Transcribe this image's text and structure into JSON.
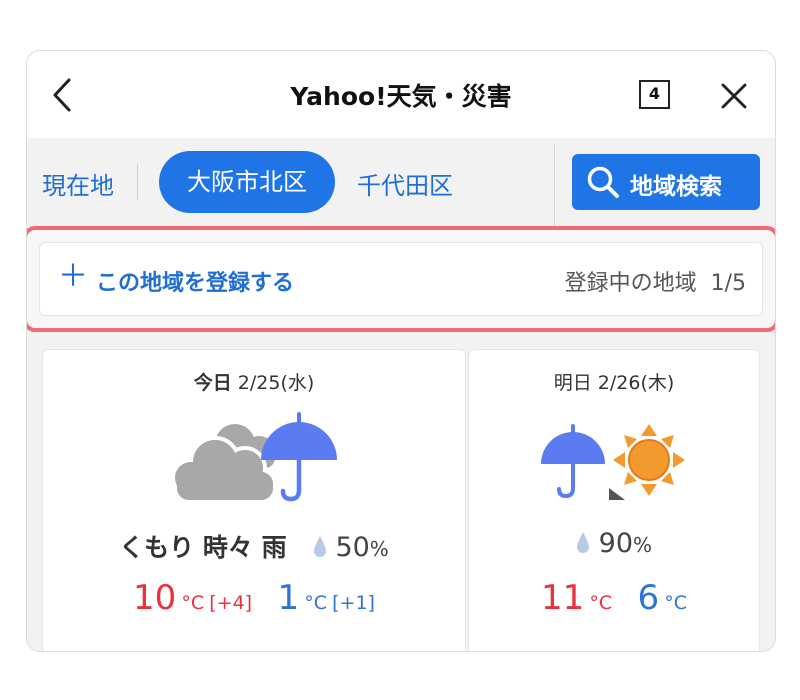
{
  "header": {
    "title": "Yahoo!天気・災害",
    "tab_count": "4",
    "back_icon": "chevron-left-icon",
    "close_icon": "close-icon"
  },
  "regions": {
    "current": "現在地",
    "selected": "大阪市北区",
    "other": "千代田区",
    "search_label": "地域検索",
    "search_icon": "search-icon"
  },
  "register": {
    "plus": "＋",
    "label": "この地域を登録する",
    "status_label": "登録中の地域",
    "status_count": "1/5"
  },
  "forecast": {
    "today": {
      "day_label": "今日",
      "date": "2/25(水)",
      "weather": "くもり 時々 雨",
      "rain_prob": "50",
      "high": "10",
      "high_diff": "[+4]",
      "low": "1",
      "low_diff": "[+1]",
      "icon": "cloud-rain-icon"
    },
    "tomorrow": {
      "day_label": "明日",
      "date": "2/26(木)",
      "rain_prob": "90",
      "high": "11",
      "low": "6",
      "icon": "rain-then-sun-icon"
    },
    "unit": "°C",
    "pct": "%"
  },
  "colors": {
    "accent": "#2075e6",
    "highlight_border": "#ee6b7a",
    "temp_high": "#e8323e",
    "temp_low": "#2e74d6",
    "umbrella": "#5b7cf0",
    "sun": "#f39a2e",
    "cloud": "#a8a8a8"
  }
}
